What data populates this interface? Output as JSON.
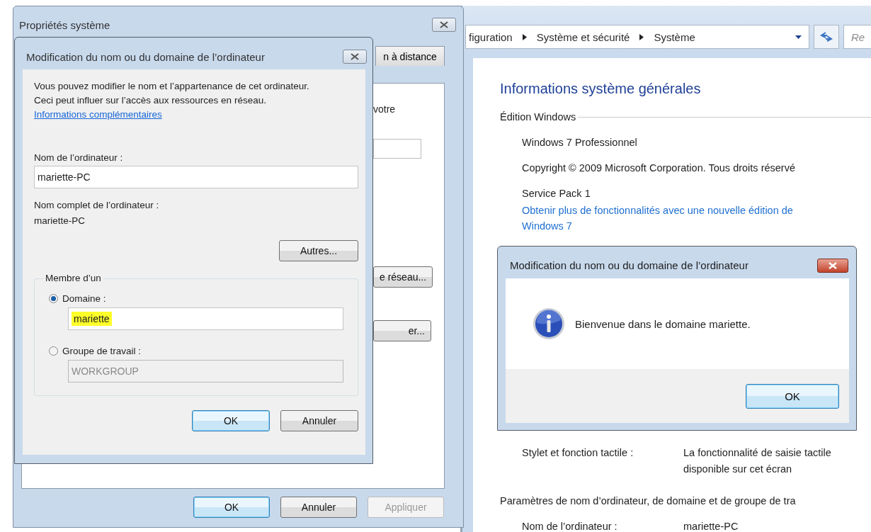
{
  "control_panel": {
    "breadcrumb": [
      "figuration",
      "Système et sécurité",
      "Système"
    ],
    "search_placeholder": "Re",
    "heading": "Informations système générales",
    "edition": {
      "title": "Édition Windows",
      "lines": [
        "Windows 7 Professionnel",
        "Copyright © 2009 Microsoft Corporation. Tous droits réservé",
        "Service Pack 1"
      ],
      "link": "Obtenir plus de fonctionnalités avec une nouvelle édition de Windows 7"
    },
    "system_rows": [
      {
        "label": "Stylet et fonction tactile :",
        "value_lines": [
          "La fonctionnalité de saisie tactile",
          "disponible sur cet écran"
        ]
      }
    ],
    "name_section": {
      "title": "Paramètres de nom d’ordinateur, de domaine et de groupe de tra",
      "rows": [
        {
          "label": "Nom de l’ordinateur :",
          "value": "mariette-PC"
        }
      ]
    }
  },
  "system_properties": {
    "title": "Propriétés système",
    "tab": {
      "label": "n à distance",
      "selected": false
    },
    "panel_fragments": [
      {
        "kind": "text",
        "text": "votre"
      },
      {
        "kind": "field"
      },
      {
        "kind": "button",
        "text": "e réseau..."
      },
      {
        "kind": "button",
        "text": "er..."
      }
    ],
    "buttons": [
      {
        "label": "OK",
        "default": true,
        "disabled": false
      },
      {
        "label": "Annuler",
        "default": false,
        "disabled": false
      },
      {
        "label": "Appliquer",
        "default": false,
        "disabled": true
      }
    ]
  },
  "rename_dialog": {
    "title": "Modification du nom ou du domaine de l’ordinateur",
    "description": "Vous pouvez modifier le nom et l’appartenance de cet ordinateur. Ceci peut influer sur l’accès aux ressources en réseau.",
    "info_link": "Informations complémentaires",
    "computer_name_label": "Nom de l’ordinateur :",
    "computer_name": "mariette-PC",
    "full_name_label": "Nom complet de l’ordinateur :",
    "full_name": "mariette-PC",
    "more_button": "Autres...",
    "member_of": {
      "title": "Membre d’un",
      "options": [
        {
          "label": "Domaine :",
          "selected": true,
          "value": "mariette",
          "highlighted": true,
          "disabled": false
        },
        {
          "label": "Groupe de travail :",
          "selected": false,
          "value": "WORKGROUP",
          "highlighted": false,
          "disabled": true
        }
      ]
    },
    "buttons": [
      {
        "label": "OK",
        "default": true,
        "disabled": false
      },
      {
        "label": "Annuler",
        "default": false,
        "disabled": false
      }
    ]
  },
  "message_box": {
    "title": "Modification du nom ou du domaine de l’ordinateur",
    "message": "Bienvenue dans le domaine mariette.",
    "buttons": [
      {
        "label": "OK",
        "default": true,
        "disabled": false
      }
    ]
  }
}
